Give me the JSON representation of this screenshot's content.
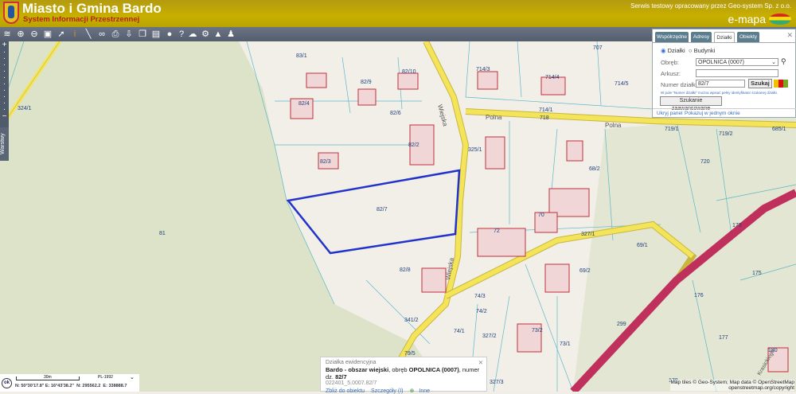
{
  "header": {
    "title": "Miasto i Gmina Bardo",
    "subtitle": "System Informacji Przestrzennej",
    "credit": "Serwis testowy opracowany przez Geo-system Sp. z o.o.",
    "brand": "e-mapa"
  },
  "toolbar": {
    "icons": [
      "layers-icon",
      "zoom-in-icon",
      "zoom-out-icon",
      "full-extent-icon",
      "select-icon",
      "info-icon",
      "measure-icon",
      "link-icon",
      "print-icon",
      "download-icon",
      "copy-icon",
      "layout-icon",
      "comment-icon",
      "help-icon",
      "cloud-icon",
      "settings-icon",
      "street-view-icon",
      "user-info-icon"
    ]
  },
  "sidebar": {
    "layers_tab": "Warstwy"
  },
  "panel": {
    "tabs": [
      "Współrzędne",
      "Adresy",
      "Działki",
      "Obiekty"
    ],
    "active_tab": "Działki",
    "radio_dzialki": "Działki",
    "radio_budynki": "Budynki",
    "obreb_label": "Obręb:",
    "obreb_value": "OPOLNICA (0007)",
    "arkusz_label": "Arkusz:",
    "arkusz_value": "",
    "numer_label": "Numer działki:",
    "numer_value": "82/7",
    "search_button": "Szukaj",
    "hint": "W pole \"Numer działki\" można wpisać pełny identyfikator szukanej działki.",
    "advanced_button": "Szukanie zaawansowane",
    "hide_link": "Ukryj panel",
    "window_link": "Pokazuj w jednym oknie"
  },
  "popup": {
    "heading": "Działka ewidencyjna",
    "place": "Bardo - obszar wiejski",
    "obreb_text": ", obręb ",
    "obreb": "OPOLNICA (0007)",
    "numer_text": ", numer dz. ",
    "numer": "82/7",
    "identifier": "022401_5.0007.82/7",
    "zoom_link": "Zbliż do obiektu",
    "details_link": "Szczegóły (I)",
    "other_link": "Inne"
  },
  "status": {
    "ok": "ok",
    "scale": "30m",
    "crs": "PL-1992",
    "lat": "N: 50°30'17.8\"",
    "lon": "E: 16°43'38.2\"",
    "n": "N: 295562.2",
    "e": "E: 338888.7"
  },
  "attribution": {
    "line1": "Map tiles © Geo-System; Map data © OpenStreetMap",
    "line2": "openstreetmap.org/copyright"
  },
  "map": {
    "labels": [
      "83/1",
      "707",
      "714/3",
      "82/9",
      "82/10",
      "714/4",
      "714/5",
      "82/4",
      "714/1",
      "82/6",
      "718",
      "Polna",
      "Polna",
      "719/1",
      "685/1",
      "719/2",
      "82/2",
      "325/1",
      "Wiejska",
      "82/3",
      "720",
      "68/2",
      "82/7",
      "81",
      "70",
      "72",
      "327/1",
      "69/1",
      "173",
      "82/8",
      "69/2",
      "175",
      "74/3",
      "176",
      "74/2",
      "341/2",
      "299",
      "74/1",
      "327/2",
      "73/2",
      "177",
      "73/1",
      "180",
      "178",
      "324/1",
      "79/5",
      "327/3",
      "Wiejska",
      "Krasickiego"
    ],
    "highlight_color": "#2233cc",
    "road_color": "#f3e45a",
    "main_road_color": "#c0305c"
  }
}
